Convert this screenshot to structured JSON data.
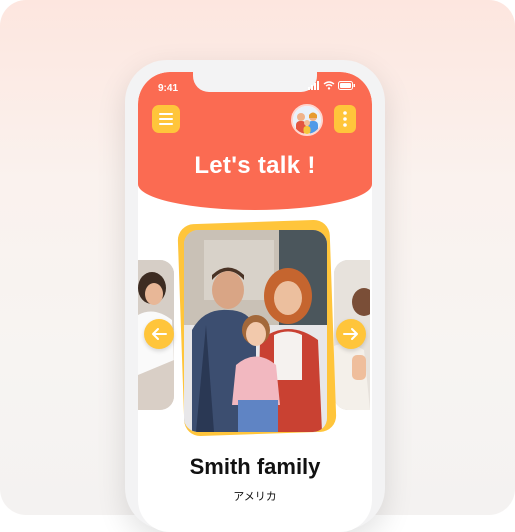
{
  "status_bar": {
    "time": "9:41"
  },
  "header": {
    "title": "Let's talk !"
  },
  "icons": {
    "menu": "hamburger-menu-icon",
    "more": "vertical-dots-icon",
    "prev": "arrow-left-icon",
    "next": "arrow-right-icon"
  },
  "carousel": {
    "current": {
      "name": "Smith family",
      "country": "アメリカ"
    }
  },
  "colors": {
    "accent": "#fb6b52",
    "button": "#ffc53b",
    "text": "#111111"
  }
}
